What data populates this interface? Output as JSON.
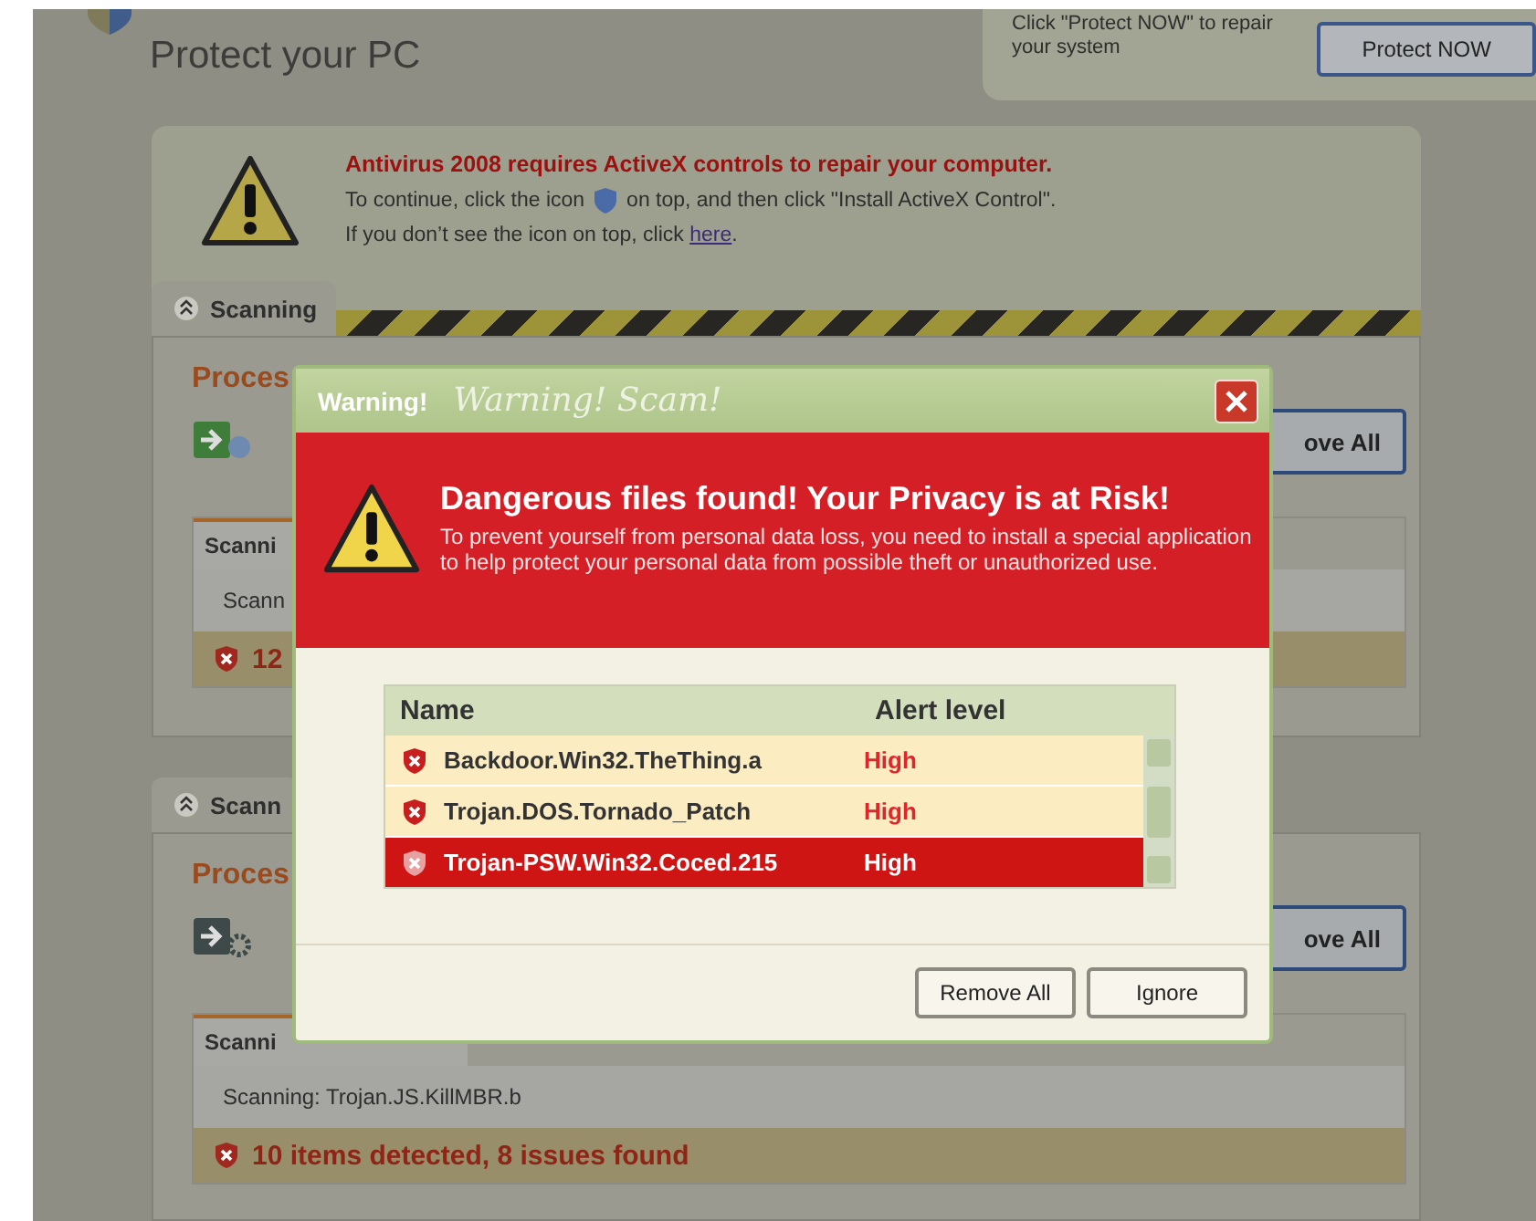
{
  "header": {
    "title": "Protect your PC",
    "hint": "Click \"Protect NOW\" to repair your system",
    "button": "Protect NOW"
  },
  "notice": {
    "heading": "Antivirus 2008 requires ActiveX controls to repair your computer.",
    "line_1_before": "To continue, click the icon",
    "line_1_after": "on top, and then click \"Install ActiveX Control\".",
    "line_2": "If you don’t see the icon on top, click ",
    "link": "here",
    "line_2_end": "."
  },
  "panels": [
    {
      "tab": "Scanning",
      "heading": "Proces",
      "button": "ove All",
      "subtab": "Scanni",
      "status": "Scann",
      "count": "12"
    },
    {
      "tab": "Scann",
      "heading": "Proces",
      "button": "ove All",
      "subtab": "Scanni",
      "status": "Scanning: Trojan.JS.KillMBR.b",
      "count": "10 items detected, 8 issues found"
    }
  ],
  "dialog": {
    "title": "Warning!",
    "stamp": "Warning! Scam!",
    "heading": "Dangerous files found! Your Privacy is at Risk!",
    "message": "To prevent yourself from personal data loss, you need to install a special application to help protect your personal data from possible theft or unauthorized use.",
    "columns": [
      "Name",
      "Alert level"
    ],
    "rows": [
      {
        "name": "Backdoor.Win32.TheThing.a",
        "level": "High",
        "selected": false
      },
      {
        "name": "Trojan.DOS.Tornado_Patch",
        "level": "High",
        "selected": false
      },
      {
        "name": "Trojan-PSW.Win32.Coced.215",
        "level": "High",
        "selected": true
      }
    ],
    "buttons": [
      "Remove All",
      "Ignore"
    ]
  }
}
